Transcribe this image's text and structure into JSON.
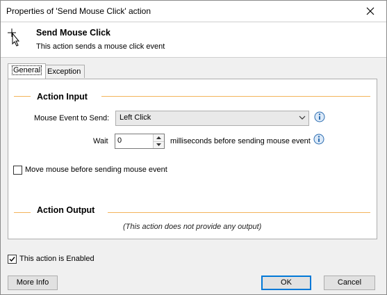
{
  "window": {
    "title": "Properties of 'Send Mouse Click' action"
  },
  "header": {
    "title": "Send Mouse Click",
    "description": "This action sends a mouse click event"
  },
  "tabs": [
    {
      "label": "General",
      "active": true
    },
    {
      "label": "Exception Handling",
      "active": false
    }
  ],
  "action_input": {
    "section_title": "Action Input",
    "mouse_event_label": "Mouse Event to Send:",
    "mouse_event_value": "Left Click",
    "wait_label": "Wait",
    "wait_value": "0",
    "wait_suffix": "milliseconds before sending mouse event",
    "move_mouse_label": "Move mouse before sending mouse event",
    "move_mouse_checked": false
  },
  "action_output": {
    "section_title": "Action Output",
    "note": "(This action does not provide any output)"
  },
  "footer": {
    "enabled_label": "This action is Enabled",
    "enabled_checked": true,
    "more_info": "More Info",
    "ok": "OK",
    "cancel": "Cancel"
  },
  "colors": {
    "accent_line": "#f3b45a",
    "info_icon": "#2b6cb0",
    "default_button_border": "#0078d7"
  },
  "icons": [
    "close-icon",
    "mouse-pointer-icon",
    "chevron-down-icon",
    "info-icon",
    "spin-up-icon",
    "spin-down-icon",
    "check-icon"
  ]
}
